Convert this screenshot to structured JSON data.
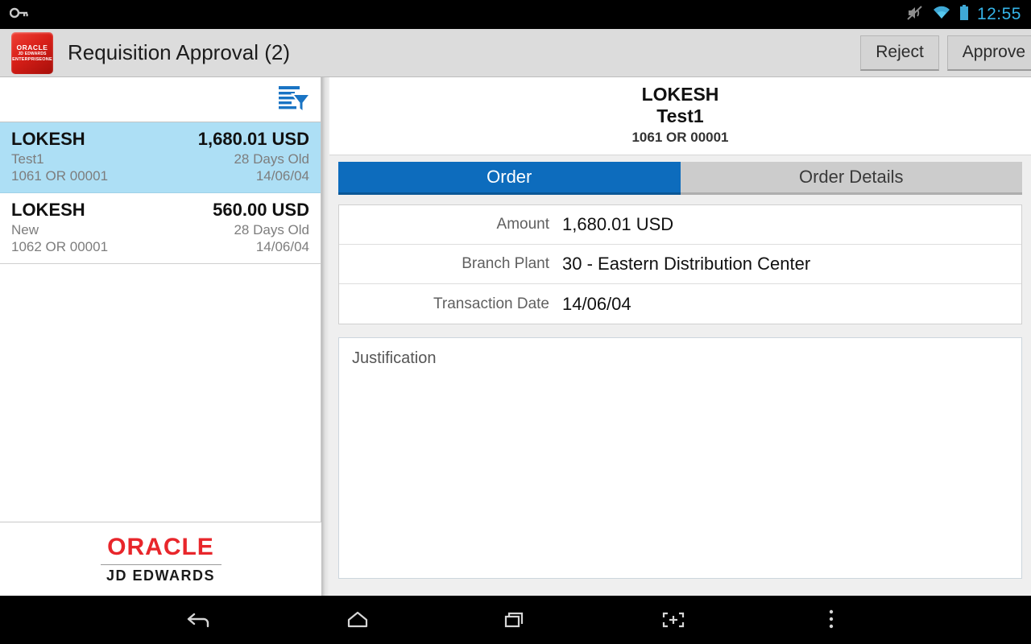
{
  "statusbar": {
    "time": "12:55",
    "icons": [
      "mute-icon",
      "wifi-icon",
      "battery-icon"
    ]
  },
  "appbar": {
    "app_icon_line1": "ORACLE",
    "app_icon_line2": "JD EDWARDS",
    "app_icon_line3": "ENTERPRISEONE",
    "title": "Requisition Approval (2)",
    "reject_label": "Reject",
    "approve_label": "Approve"
  },
  "left_panel": {
    "filter_icon": "filter-list-icon",
    "items": [
      {
        "name": "LOKESH",
        "amount": "1,680.01 USD",
        "status": "Test1",
        "age": "28 Days Old",
        "doc": "1061 OR 00001",
        "date": "14/06/04",
        "selected": true
      },
      {
        "name": "LOKESH",
        "amount": "560.00 USD",
        "status": "New",
        "age": "28 Days Old",
        "doc": "1062 OR 00001",
        "date": "14/06/04",
        "selected": false
      }
    ],
    "footer": {
      "oracle": "ORACLE",
      "product": "JD EDWARDS"
    }
  },
  "detail": {
    "header": {
      "name": "LOKESH",
      "subtitle": "Test1",
      "document": "1061 OR 00001"
    },
    "tabs": [
      {
        "label": "Order",
        "active": true
      },
      {
        "label": "Order Details",
        "active": false
      }
    ],
    "fields": [
      {
        "label": "Amount",
        "value": "1,680.01 USD"
      },
      {
        "label": "Branch Plant",
        "value": "30 - Eastern Distribution Center"
      },
      {
        "label": "Transaction Date",
        "value": "14/06/04"
      }
    ],
    "justification_placeholder": "Justification"
  },
  "navbar": {
    "buttons": [
      "back-icon",
      "home-icon",
      "recents-icon",
      "screenshot-icon",
      "overflow-menu-icon"
    ]
  },
  "colors": {
    "accent_blue": "#0d6cbd",
    "selected_row": "#addff5",
    "oracle_red": "#e8262b",
    "status_time": "#35b4e8"
  }
}
